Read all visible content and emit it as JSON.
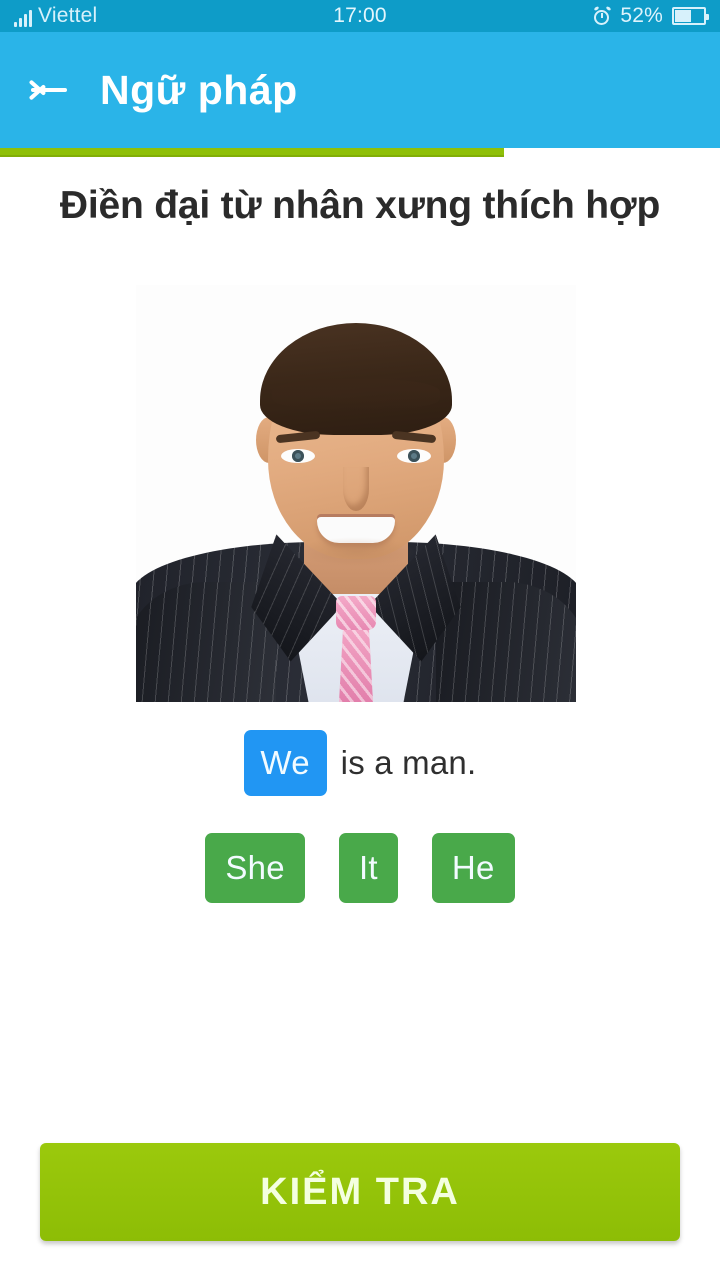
{
  "statusbar": {
    "carrier": "Viettel",
    "time": "17:00",
    "battery_percent": "52%",
    "battery_level": 52,
    "signal_icon": "signal-bars-icon",
    "alarm_icon": "alarm-clock-icon",
    "battery_icon": "battery-icon",
    "background_color": "#0e9cc8"
  },
  "appbar": {
    "title": "Ngữ pháp",
    "back_icon": "back-arrow-icon",
    "background_color": "#2ab4e8"
  },
  "progress": {
    "percent": 70,
    "fill_color": "#8fc008",
    "track_color": "#ffffff"
  },
  "exercise": {
    "question": "Điền đại từ nhân xưng thích hợp",
    "illustration": {
      "alt": "photo-of-smiling-man-in-dark-pinstripe-suit-with-pink-tie",
      "name": "exercise-image"
    },
    "answer": {
      "selected_value": "We",
      "selected_color": "#2196f3",
      "sentence_tail": "is a man."
    },
    "options": [
      {
        "label": "She",
        "color": "#49a94a"
      },
      {
        "label": "It",
        "color": "#49a94a"
      },
      {
        "label": "He",
        "color": "#49a94a"
      }
    ]
  },
  "submit": {
    "label": "KIỂM TRA",
    "color": "#96c60a"
  }
}
